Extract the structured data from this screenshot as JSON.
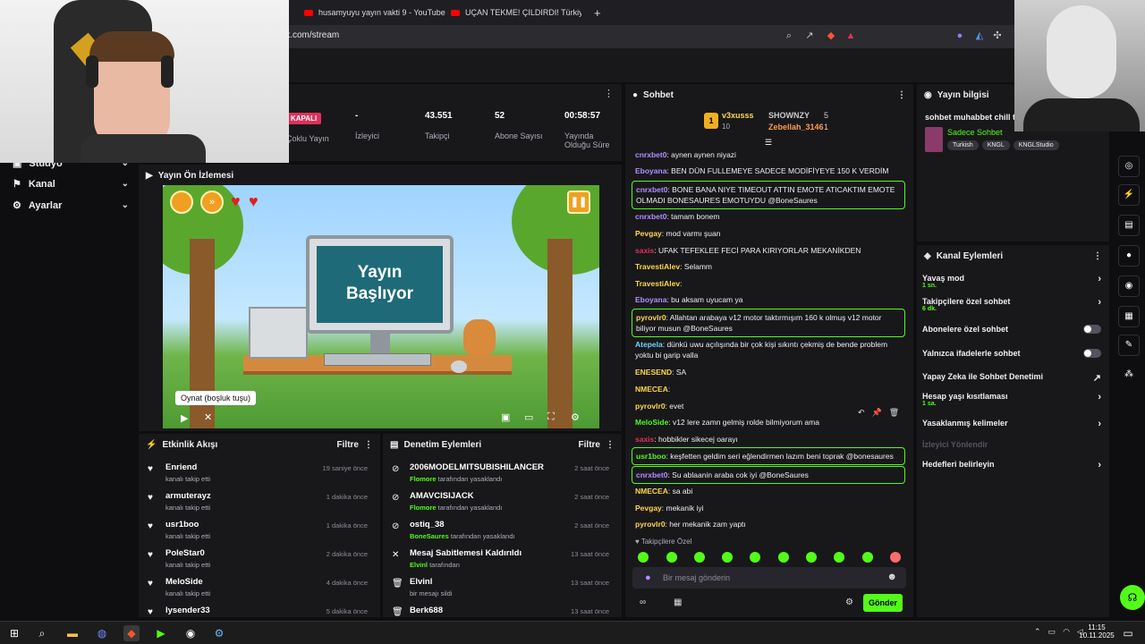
{
  "browser": {
    "tabs": [
      {
        "title": "husamyuyu yayın vakti 9 - YouTube"
      },
      {
        "title": "UÇAN TEKME! ÇILDIRDI! Türkiye'de "
      }
    ],
    "new_tab": "+",
    "url": "ick.com/stream"
  },
  "nav": {
    "studio": "Stüdyo",
    "kanal": "Kanal",
    "ayarlar": "Ayarlar"
  },
  "stats": {
    "status_badge": "KAPALI",
    "status_label": "Çoklu Yayın",
    "viewers_value": "-",
    "viewers_label": "İzleyici",
    "followers_value": "43.551",
    "followers_label": "Takipçi",
    "subs_value": "52",
    "subs_label": "Abone Sayısı",
    "duration_value": "00:58:57",
    "duration_label": "Yayında Olduğu Süre"
  },
  "preview": {
    "title": "Yayın Ön İzlemesi",
    "scene_line1": "Yayın",
    "scene_line2": "Başlıyor",
    "tooltip": "Oynat (boşluk tuşu)"
  },
  "activity": {
    "title": "Etkinlik Akışı",
    "filter": "Filtre",
    "items": [
      {
        "name": "Enriend",
        "sub": "kanalı takip etti",
        "time": "19 saniye önce"
      },
      {
        "name": "armuterayz",
        "sub": "kanalı takip etti",
        "time": "1 dakika önce"
      },
      {
        "name": "usr1boo",
        "sub": "kanalı takip etti",
        "time": "1 dakika önce"
      },
      {
        "name": "PoleStar0",
        "sub": "kanalı takip etti",
        "time": "2 dakika önce"
      },
      {
        "name": "MeloSide",
        "sub": "kanalı takip etti",
        "time": "4 dakika önce"
      },
      {
        "name": "lysender33",
        "sub": "",
        "time": "5 dakika önce"
      }
    ]
  },
  "moderation": {
    "title": "Denetim Eylemleri",
    "filter": "Filtre",
    "items": [
      {
        "name": "2006MODELMITSUBISHILANCER",
        "by": "Flomore",
        "sub": " tarafından yasaklandı",
        "time": "2 saat önce"
      },
      {
        "name": "AMAVCISIJACK",
        "by": "Flomore",
        "sub": " tarafından yasaklandı",
        "time": "2 saat önce"
      },
      {
        "name": "ostiq_38",
        "by": "BoneSaures",
        "sub": " tarafından yasaklandı",
        "time": "2 saat önce"
      },
      {
        "name": "Mesaj Sabitlemesi Kaldırıldı",
        "by": "Elvinl",
        "sub": " tarafından",
        "time": "13 saat önce"
      },
      {
        "name": "Elvinl",
        "by": "",
        "sub": "bir mesajı sildi",
        "time": "13 saat önce"
      },
      {
        "name": "Berk688",
        "by": "",
        "sub": "",
        "time": "13 saat önce"
      }
    ]
  },
  "chat": {
    "title": "Sohbet",
    "top": [
      {
        "rank": "1",
        "name": "v3xusss",
        "count": "10"
      },
      {
        "name": "SHOWNZY",
        "count": "5"
      },
      {
        "name": "Zebellah_3146",
        "count": "1"
      }
    ],
    "messages": [
      {
        "user": "cnrxbet0",
        "color": "#b48eff",
        "text": ": aynen aynen niyazi",
        "hl": false
      },
      {
        "user": "Eboyana",
        "color": "#b48eff",
        "text": ": BEN DÜN FULLEMEYE SADECE MODİFİYEYE 150 K VERDİM",
        "hl": false
      },
      {
        "user": "cnrxbet0",
        "color": "#b48eff",
        "text": ": BONE BANA NIYE TIMEOUT ATTIN EMOTE ATICAKTIM EMOTE OLMADI BONESAURES EMOTUYDU @BoneSaures",
        "hl": true
      },
      {
        "user": "cnrxbet0",
        "color": "#b48eff",
        "text": ": tamam bonem",
        "hl": false
      },
      {
        "user": "Pevgay",
        "color": "#ffd84a",
        "text": ": mod varmı şuan",
        "hl": false
      },
      {
        "user": "saxis",
        "color": "#e0305a",
        "text": ": UFAK TEFEKLEE FECİ PARA KIRIYORLAR MEKANİKDEN",
        "hl": false
      },
      {
        "user": "TravestiAlev",
        "color": "#ffd84a",
        "text": ": Selamm",
        "hl": false
      },
      {
        "user": "TravestiAlev",
        "color": "#ffd84a",
        "text": ":",
        "hl": false
      },
      {
        "user": "Eboyana",
        "color": "#b48eff",
        "text": ": bu aksam uyucam ya",
        "hl": false
      },
      {
        "user": "pyrovlr0",
        "color": "#ffd84a",
        "text": ": Allahtan arabaya v12 motor taktırmışım 160 k olmuş v12 motor biliyor musun @BoneSaures",
        "hl": true
      },
      {
        "user": "Atepela",
        "color": "#6ad6ff",
        "text": ": dünkü uwu açılışında bir çok kişi sıkıntı çekmiş de bende problem yoktu bi garip valla",
        "hl": false
      },
      {
        "user": "ENESEND",
        "color": "#ffd84a",
        "text": ": SA",
        "hl": false
      },
      {
        "user": "NMECEA",
        "color": "#ffd84a",
        "text": ":",
        "hl": false
      },
      {
        "user": "pyrovlr0",
        "color": "#ffd84a",
        "text": ": evet",
        "hl": false
      },
      {
        "user": "MeloSide",
        "color": "#53fc18",
        "text": ": v12 lere zamn gelmiş rolde bilmiyorum ama",
        "hl": false
      },
      {
        "user": "saxis",
        "color": "#e0305a",
        "text": ": hobbikler sikecej oarayı",
        "hl": false
      },
      {
        "user": "usr1boo",
        "color": "#53fc18",
        "text": ": keşfetten geldim seri eğlendirmen lazım beni toprak @bonesaures",
        "hl": true
      },
      {
        "user": "cnrxbet0",
        "color": "#b48eff",
        "text": ": Su ablaanin araba cok iyi @BoneSaures",
        "hl": true
      },
      {
        "user": "NMECEA",
        "color": "#ffd84a",
        "text": ": sa abi",
        "hl": false
      },
      {
        "user": "Pevgay",
        "color": "#ffd84a",
        "text": ": mekanik iyi",
        "hl": false
      },
      {
        "user": "pyrovlr0",
        "color": "#ffd84a",
        "text": ": her mekanik zam yaptı",
        "hl": false
      }
    ],
    "followers_only": "Takipçilere Özel",
    "input_placeholder": "Bir mesaj gönderin",
    "send": "Gönder"
  },
  "info": {
    "title": "Yayın bilgisi",
    "stream_title": "sohbet muhabbet chill ta",
    "category": "Sadece Sohbet",
    "tags": [
      "Turkish",
      "KNGL",
      "KNGLStudio"
    ]
  },
  "actions": {
    "title": "Kanal Eylemleri",
    "slow_mode": "Yavaş mod",
    "slow_mode_val": "1 sn.",
    "followers_chat": "Takipçilere özel sohbet",
    "followers_chat_val": "6 dk.",
    "subs_chat": "Abonelere özel sohbet",
    "emotes_chat": "Yalnızca ifadelerle sohbet",
    "ai_mod": "Yapay Zeka ile Sohbet Denetimi",
    "age_limit": "Hesap yaşı kısıtlaması",
    "age_limit_val": "1 sa.",
    "banned_words": "Yasaklanmış kelimeler",
    "viewer_redirect": "İzleyici Yönlendir",
    "goals": "Hedefleri belirleyin"
  },
  "taskbar": {
    "time": "11:15",
    "date": "10.11.2025"
  },
  "colors": {
    "accent": "#53fc18",
    "panel": "#18181b",
    "background": "#0e0e10"
  }
}
